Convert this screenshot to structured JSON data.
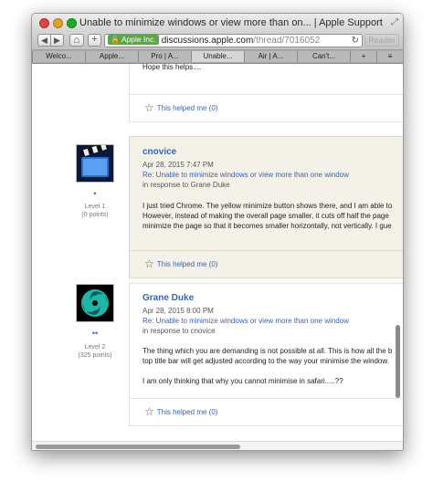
{
  "window": {
    "title": "Unable to minimize windows or view more than on... | Apple Support Communities"
  },
  "toolbar": {
    "back_icon": "◀",
    "forward_icon": "▶",
    "home_icon": "⌂",
    "add_icon": "+",
    "ev_company": "Apple Inc.",
    "host": "discussions.apple.com",
    "path": "/thread/7016052",
    "reload_icon": "↻",
    "reader_label": "Reader"
  },
  "tabs": [
    {
      "label": "Welco..."
    },
    {
      "label": "Apple..."
    },
    {
      "label": "Pro | A..."
    },
    {
      "label": "Unable..."
    },
    {
      "label": "Air | A..."
    },
    {
      "label": "Can't..."
    }
  ],
  "tabbar_icons": {
    "new_tab": "+",
    "overview": "≡"
  },
  "posts": [
    {
      "body": [
        "Hope this helps...."
      ],
      "helped": "This helped me (0)"
    },
    {
      "author": "cnovice",
      "date": "Apr 28, 2015 7:47 PM",
      "reply_title": "Re: Unable to minimize windows or view more than one window",
      "in_response": "in response to Grane Duke",
      "dots": "•",
      "level": "Level 1",
      "points": "(0 points)",
      "body": [
        "I just tried Chrome. The yellow minimize button shows there, and I am able to",
        "However, instead of making the overall page smaller, it cuts off half the page",
        "minimize the page so that it becomes smaller horizontally, not vertically. I gue"
      ],
      "helped": "This helped me (0)"
    },
    {
      "author": "Grane Duke",
      "date": "Apr 28, 2015 8:00 PM",
      "reply_title": "Re: Unable to minimize windows or view more than one window",
      "in_response": "in response to cnovice",
      "dots": "••",
      "level": "Level 2",
      "points": "(325 points)",
      "body": [
        "The thing which you are demanding is not possible at all. This is how all the b",
        "top title bar will get adjusted according to the way your minimise the window.",
        "",
        "I am only thinking that why you cannot minimise in safari.....??"
      ],
      "helped": "This helped me (0)"
    }
  ],
  "colors": {
    "link": "#3b64a8",
    "highlight_bg": "#f4f2e8",
    "ev_green": "#5da54a"
  }
}
